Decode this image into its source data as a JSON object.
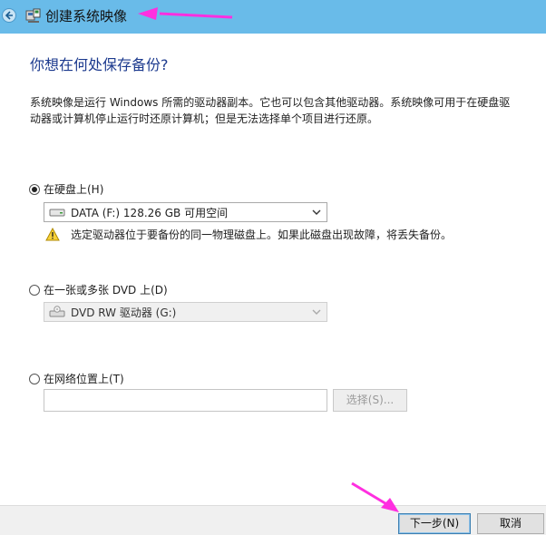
{
  "window": {
    "title": "创建系统映像"
  },
  "main": {
    "heading": "你想在何处保存备份?",
    "description": "系统映像是运行 Windows 所需的驱动器副本。它也可以包含其他驱动器。系统映像可用于在硬盘驱动器或计算机停止运行时还原计算机；但是无法选择单个项目进行还原。"
  },
  "options": {
    "hard_disk": {
      "label": "在硬盘上(H)",
      "selected": true,
      "drive_value": "DATA (F:)  128.26 GB 可用空间",
      "warning": "选定驱动器位于要备份的同一物理磁盘上。如果此磁盘出现故障，将丢失备份。"
    },
    "dvd": {
      "label": "在一张或多张 DVD 上(D)",
      "selected": false,
      "drive_value": "DVD RW 驱动器 (G:)"
    },
    "network": {
      "label": "在网络位置上(T)",
      "selected": false,
      "path_value": "",
      "browse_label": "选择(S)..."
    }
  },
  "footer": {
    "next_label": "下一步(N)",
    "cancel_label": "取消"
  },
  "colors": {
    "titlebar": "#69bbe9",
    "heading": "#1c3a8e",
    "annotation_arrow": "#ff2fe0"
  },
  "icons": [
    "back-arrow-icon",
    "system-image-icon",
    "hard-drive-icon",
    "warning-icon",
    "dvd-drive-icon",
    "chevron-down-icon"
  ]
}
